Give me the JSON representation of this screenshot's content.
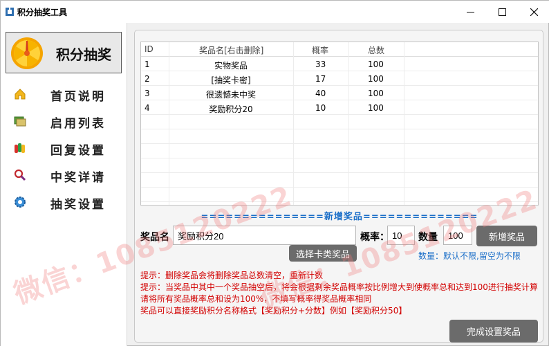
{
  "window": {
    "title": "积分抽奖工具",
    "controls": {
      "minimize": "—",
      "maximize": "☐",
      "close": "✕"
    }
  },
  "sidebar": {
    "logo_text": "积分抽奖",
    "items": [
      {
        "label": "首页说明",
        "icon": "home-icon"
      },
      {
        "label": "启用列表",
        "icon": "list-icon"
      },
      {
        "label": "回复设置",
        "icon": "reply-icon"
      },
      {
        "label": "中奖详请",
        "icon": "search-icon"
      },
      {
        "label": "抽奖设置",
        "icon": "gear-icon"
      }
    ]
  },
  "table": {
    "headers": [
      "ID",
      "奖品名[右击删除]",
      "概率",
      "总数"
    ],
    "rows": [
      [
        "1",
        "实物奖品",
        "33",
        "100"
      ],
      [
        "2",
        "[抽奖卡密]",
        "17",
        "100"
      ],
      [
        "3",
        "很遗憾未中奖",
        "40",
        "100"
      ],
      [
        "4",
        "奖励积分20",
        "10",
        "100"
      ]
    ]
  },
  "form": {
    "section_title": "===============新增奖品==============",
    "prize_label": "奖品名",
    "prize_value": "奖励积分20",
    "prob_label": "概率：",
    "prob_value": "10",
    "qty_label": "数量",
    "qty_value": "100",
    "add_button": "新增奖品",
    "card_button": "选择卡类奖品",
    "qty_hint": "数量：默认不限,留空为不限"
  },
  "tips": [
    "提示：删除奖品会将删除奖品总数清空，重新计数",
    "提示：当奖品中其中一个奖品抽空后，将会根据剩余奖品概率按比例增大到使概率总和达到100进行抽奖计算",
    "请将所有奖品概率总和设为100%，不填写概率得奖品概率相同",
    "奖品可以直接奖励积分名称格式【奖励积分+分数】例如【奖励积分50】"
  ],
  "finish_button": "完成设置奖品",
  "watermark": {
    "left": "微信：1085120222",
    "right": "微信：1085120222"
  },
  "colors": {
    "accent_blue": "#1a6ec8",
    "tip_red": "#d20000",
    "button_gray": "#6b6b6b"
  }
}
